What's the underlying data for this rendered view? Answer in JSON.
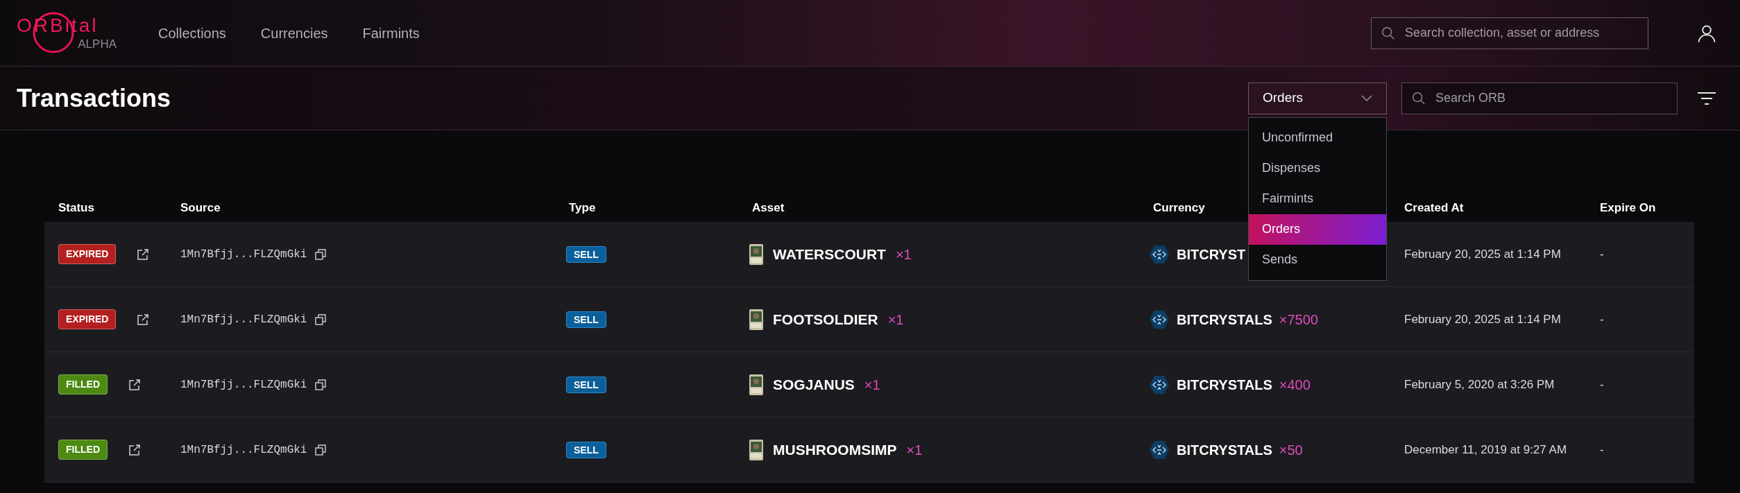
{
  "header": {
    "logo": {
      "name": "ORBital",
      "tag": "ALPHA"
    },
    "nav": [
      {
        "label": "Collections"
      },
      {
        "label": "Currencies"
      },
      {
        "label": "Fairmints"
      }
    ],
    "search": {
      "placeholder": "Search collection, asset or address"
    }
  },
  "page": {
    "title": "Transactions",
    "type_select": {
      "value": "Orders",
      "expanded": true,
      "options": [
        {
          "label": "Unconfirmed",
          "selected": false
        },
        {
          "label": "Dispenses",
          "selected": false
        },
        {
          "label": "Fairmints",
          "selected": false
        },
        {
          "label": "Orders",
          "selected": true
        },
        {
          "label": "Sends",
          "selected": false
        }
      ]
    },
    "search": {
      "placeholder": "Search ORB"
    }
  },
  "table": {
    "columns": [
      "Status",
      "Source",
      "Type",
      "Asset",
      "Currency",
      "Created At",
      "Expire On"
    ],
    "rows": [
      {
        "status": {
          "label": "EXPIRED",
          "color": "#b3201f"
        },
        "source": "1Mn7Bfjj...FLZQmGki",
        "type": "SELL",
        "asset": {
          "name": "WATERSCOURT",
          "quantity": "×1"
        },
        "currency": {
          "name": "BITCRYST"
        },
        "created": "February 20, 2025 at 1:14 PM",
        "expire": "-"
      },
      {
        "status": {
          "label": "EXPIRED",
          "color": "#b3201f"
        },
        "source": "1Mn7Bfjj...FLZQmGki",
        "type": "SELL",
        "asset": {
          "name": "FOOTSOLDIER",
          "quantity": "×1"
        },
        "currency": {
          "name": "BITCRYSTALS",
          "quantity": "×7500"
        },
        "created": "February 20, 2025 at 1:14 PM",
        "expire": "-"
      },
      {
        "status": {
          "label": "FILLED",
          "color": "#4c8a12"
        },
        "source": "1Mn7Bfjj...FLZQmGki",
        "type": "SELL",
        "asset": {
          "name": "SOGJANUS",
          "quantity": "×1"
        },
        "currency": {
          "name": "BITCRYSTALS",
          "quantity": "×400"
        },
        "created": "February 5, 2020 at 3:26 PM",
        "expire": "-"
      },
      {
        "status": {
          "label": "FILLED",
          "color": "#4c8a12"
        },
        "source": "1Mn7Bfjj...FLZQmGki",
        "type": "SELL",
        "asset": {
          "name": "MUSHROOMSIMP",
          "quantity": "×1"
        },
        "currency": {
          "name": "BITCRYSTALS",
          "quantity": "×50"
        },
        "created": "December 11, 2019 at 9:27 AM",
        "expire": "-"
      }
    ]
  }
}
